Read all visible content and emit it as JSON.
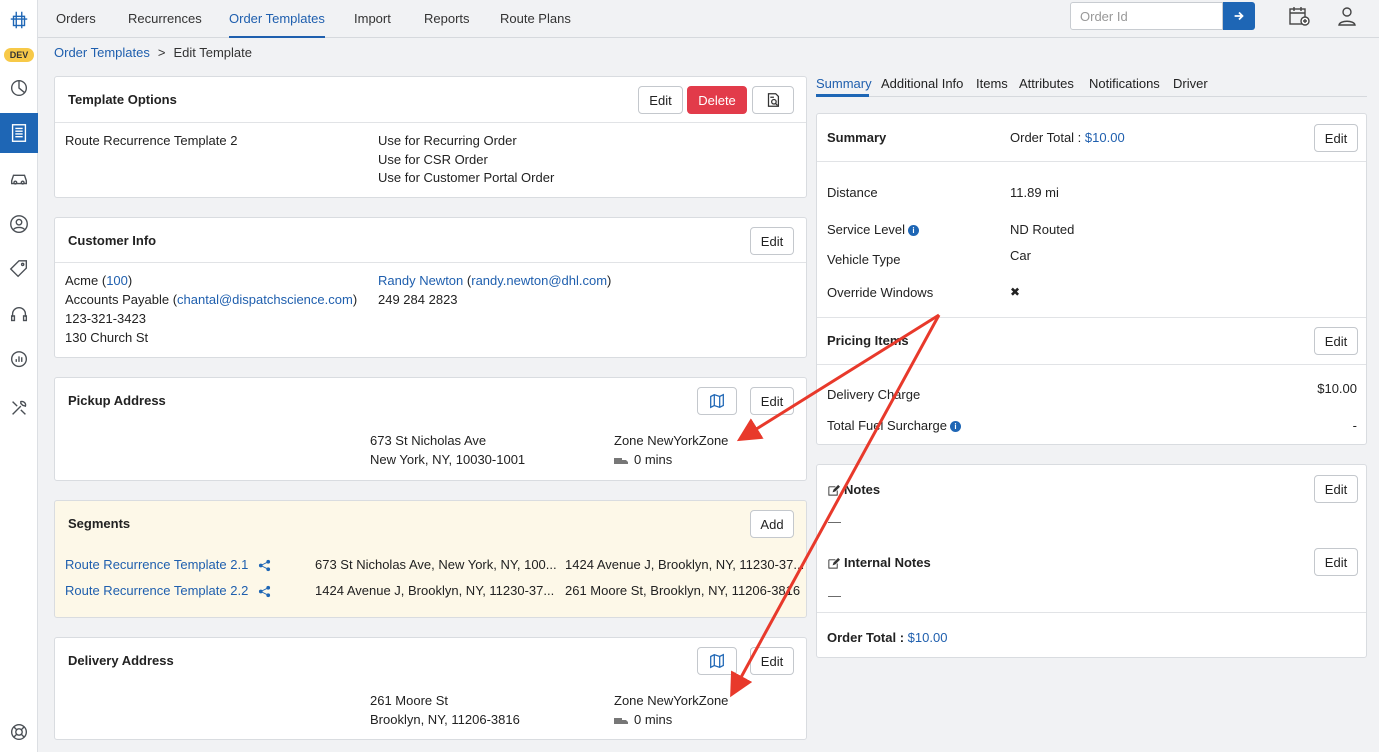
{
  "rail": {
    "dev_badge": "DEV"
  },
  "topnav": {
    "tabs": [
      "Orders",
      "Recurrences",
      "Order Templates",
      "Import",
      "Reports",
      "Route Plans"
    ],
    "active_tab": "Order Templates",
    "order_id_placeholder": "Order Id"
  },
  "breadcrumb": {
    "parent": "Order Templates",
    "separator": ">",
    "current": "Edit Template"
  },
  "template_options": {
    "title": "Template Options",
    "edit": "Edit",
    "delete": "Delete",
    "name": "Route Recurrence Template 2",
    "uses": [
      "Use for Recurring Order",
      "Use for CSR Order",
      "Use for Customer Portal Order"
    ]
  },
  "customer_info": {
    "title": "Customer Info",
    "edit": "Edit",
    "company": "Acme",
    "company_id": "100",
    "billing_label": "Accounts Payable",
    "billing_email": "chantal@dispatchscience.com",
    "phone": "123-321-3423",
    "address": "130 Church St",
    "contact_name": "Randy Newton",
    "contact_email": "randy.newton@dhl.com",
    "contact_phone": "249 284 2823"
  },
  "pickup": {
    "title": "Pickup Address",
    "edit": "Edit",
    "line1": "673 St Nicholas Ave",
    "line2": "New York, NY, 10030-1001",
    "zone": "Zone NewYorkZone",
    "wait": "0 mins"
  },
  "segments": {
    "title": "Segments",
    "add": "Add",
    "rows": [
      {
        "name": "Route Recurrence Template 2.1",
        "from": "673 St Nicholas Ave, New York, NY, 100...",
        "to": "1424 Avenue J, Brooklyn, NY, 11230-37..."
      },
      {
        "name": "Route Recurrence Template 2.2",
        "from": "1424 Avenue J, Brooklyn, NY, 11230-37...",
        "to": "261 Moore St, Brooklyn, NY, 11206-3816"
      }
    ]
  },
  "delivery": {
    "title": "Delivery Address",
    "edit": "Edit",
    "line1": "261 Moore St",
    "line2": "Brooklyn, NY, 11206-3816",
    "zone": "Zone NewYorkZone",
    "wait": "0 mins"
  },
  "right_tabs": [
    "Summary",
    "Additional Info",
    "Items",
    "Attributes",
    "Notifications",
    "Driver"
  ],
  "summary": {
    "title": "Summary",
    "order_total_label": "Order Total :",
    "order_total": "$10.00",
    "edit": "Edit",
    "fields": [
      {
        "label": "Distance",
        "value": "11.89 mi"
      },
      {
        "label": "Service Level",
        "value": "ND Routed"
      },
      {
        "label": "Vehicle Type",
        "value": "Car"
      },
      {
        "label": "Override Windows",
        "value": "✖"
      }
    ]
  },
  "pricing": {
    "title": "Pricing Items",
    "edit": "Edit",
    "items": [
      {
        "label": "Delivery Charge",
        "value": "$10.00"
      },
      {
        "label": "Total Fuel Surcharge",
        "value": "-"
      }
    ]
  },
  "notes": {
    "notes_title": "Notes",
    "notes_value": "—",
    "internal_title": "Internal Notes",
    "internal_value": "—",
    "edit": "Edit",
    "order_total_label": "Order Total :",
    "order_total": "$10.00"
  },
  "colors": {
    "accent": "#1e66b5",
    "danger": "#e23b4a",
    "segments_bg": "#fdf8e8",
    "annotation": "#e8392b"
  }
}
